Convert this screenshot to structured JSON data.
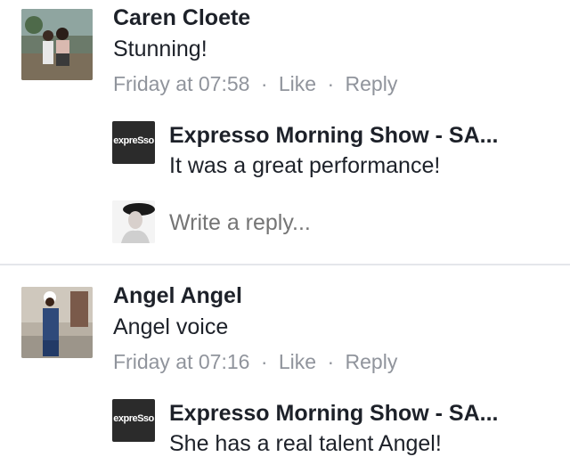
{
  "comments": [
    {
      "author": "Caren Cloete",
      "text": "Stunning!",
      "time": "Friday at 07:58",
      "sep1": "·",
      "like": "Like",
      "sep2": "·",
      "reply": "Reply",
      "replies": [
        {
          "author": "Expresso Morning Show - SA...",
          "text": "It was a great performance!",
          "logo": "expreSso"
        }
      ],
      "write_reply_placeholder": "Write a reply..."
    },
    {
      "author": "Angel Angel",
      "text": "Angel voice",
      "time": "Friday at 07:16",
      "sep1": "·",
      "like": "Like",
      "sep2": "·",
      "reply": "Reply",
      "replies": [
        {
          "author": "Expresso Morning Show - SA...",
          "text": "She has a real talent Angel!",
          "logo": "expreSso"
        }
      ]
    }
  ]
}
